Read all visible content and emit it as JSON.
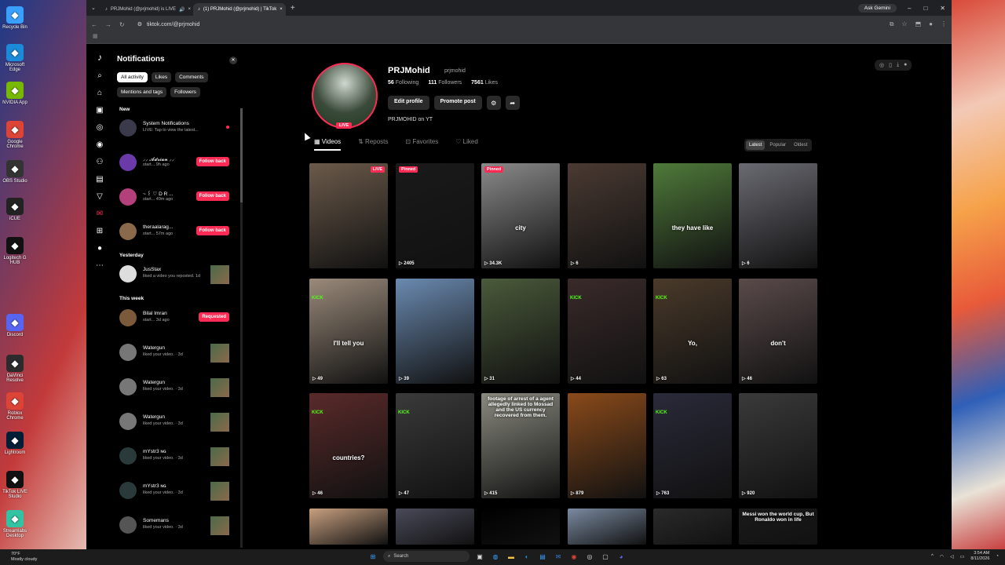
{
  "desktop": {
    "icons": [
      {
        "label": "Recycle Bin",
        "icon": "recycle-bin-icon",
        "color": "#3aa0ff"
      },
      {
        "label": "Microsoft Edge",
        "icon": "edge-icon",
        "color": "#1b8ad8"
      },
      {
        "label": "NVIDIA App",
        "icon": "nvidia-icon",
        "color": "#76b900"
      },
      {
        "label": "Google Chrome",
        "icon": "chrome-icon",
        "color": "#db4437"
      },
      {
        "label": "OBS Studio",
        "icon": "obs-icon",
        "color": "#333333"
      },
      {
        "label": "iCUE",
        "icon": "icue-icon",
        "color": "#222222"
      },
      {
        "label": "Logitech G HUB",
        "icon": "logitech-icon",
        "color": "#111111"
      },
      {
        "label": "Discord",
        "icon": "discord-icon",
        "color": "#5865f2"
      },
      {
        "label": "DaVinci Resolve",
        "icon": "davinci-icon",
        "color": "#2b2b2b"
      },
      {
        "label": "Roblox Chrome",
        "icon": "chrome-icon",
        "color": "#db4437"
      },
      {
        "label": "Lightroom",
        "icon": "lightroom-icon",
        "color": "#001e36"
      },
      {
        "label": "TikTok LIVE Studio",
        "icon": "tiktok-icon",
        "color": "#111111"
      },
      {
        "label": "Streamlabs Desktop",
        "icon": "streamlabs-icon",
        "color": "#31c3a2"
      }
    ]
  },
  "browser": {
    "tabs": [
      {
        "title": "PRJMohid (@prjmohid) is LIVE",
        "active": false
      },
      {
        "title": "(1) PRJMohid (@prjmohid) | TikTok",
        "active": true
      }
    ],
    "gemini_label": "Ask Gemini",
    "url": "tiktok.com/@prjmohid"
  },
  "notifications": {
    "title": "Notifications",
    "filters": [
      "All activity",
      "Likes",
      "Comments",
      "Mentions and tags",
      "Followers"
    ],
    "sections": {
      "new": "New",
      "yesterday": "Yesterday",
      "this_week": "This week"
    },
    "items": [
      {
        "name": "System Notifications",
        "sub": "LIVE: Tap to view the latest...",
        "action": "",
        "avatar_color": "#3a3a4a"
      },
      {
        "name": "⸝⸝ 𝓐𝓭𝓻𝓲𝓪𝓷 ⸝⸝",
        "sub": "start... 9h ago",
        "action": "Follow back",
        "avatar_color": "#6a3aa8"
      },
      {
        "name": "~ ꒰ ♡ D R ...",
        "sub": "start... 49m ago",
        "action": "Follow back",
        "avatar_color": "#b3407a"
      },
      {
        "name": "theraalarag...",
        "sub": "start... 57m ago",
        "action": "Follow back",
        "avatar_color": "#8a6a4a"
      },
      {
        "name": "JusStax",
        "sub": "liked a video you reposted. 1d",
        "action": "",
        "avatar_color": "#dddddd"
      },
      {
        "name": "Bilal Imran",
        "sub": "start... 3d ago",
        "action": "Requested",
        "avatar_color": "#7a5a3a"
      },
      {
        "name": "Watergun",
        "sub": "liked your video. · 3d",
        "action": "",
        "avatar_color": "#777777"
      },
      {
        "name": "Watergun",
        "sub": "liked your video. · 3d",
        "action": "",
        "avatar_color": "#777777"
      },
      {
        "name": "Watergun",
        "sub": "liked your video. · 3d",
        "action": "",
        "avatar_color": "#777777"
      },
      {
        "name": "mYstr3 ɴɢ",
        "sub": "liked your video. · 3d",
        "action": "",
        "avatar_color": "#2a3a3a"
      },
      {
        "name": "mYstr3 ɴɢ",
        "sub": "liked your video. · 3d",
        "action": "",
        "avatar_color": "#2a3a3a"
      },
      {
        "name": "Somemans",
        "sub": "liked your video. · 3d",
        "action": "",
        "avatar_color": "#555555"
      }
    ]
  },
  "profile": {
    "name": "PRJMohid",
    "handle": "prjmohid",
    "following": "56",
    "following_label": "Following",
    "followers": "111",
    "followers_label": "Followers",
    "likes": "7561",
    "likes_label": "Likes",
    "live_label": "LIVE",
    "edit_label": "Edit profile",
    "promote_label": "Promote post",
    "bio": "PRJMOHID on YT",
    "tabs": [
      "Videos",
      "Reposts",
      "Favorites",
      "Liked"
    ],
    "sort": [
      "Latest",
      "Popular",
      "Oldest"
    ]
  },
  "videos": [
    {
      "views": "",
      "badge": "LIVE",
      "caption": "",
      "kick": "",
      "color": "#6b5a4a"
    },
    {
      "views": "2405",
      "badge": "Pinned",
      "caption": "",
      "kick": "",
      "color": "#1a1a1a"
    },
    {
      "views": "34.3K",
      "badge": "Pinned",
      "caption": "city",
      "kick": "",
      "color": "#8a8a8a"
    },
    {
      "views": "6",
      "badge": "",
      "caption": "",
      "kick": "",
      "color": "#4a3a32"
    },
    {
      "views": "",
      "badge": "",
      "caption": "they have like",
      "kick": "",
      "color": "#4f7a3a"
    },
    {
      "views": "6",
      "badge": "",
      "caption": "",
      "kick": "",
      "color": "#6a6a72"
    },
    {
      "views": "49",
      "badge": "",
      "caption": "I'll tell you",
      "kick": "KICK",
      "color": "#9a8a7a"
    },
    {
      "views": "39",
      "badge": "",
      "caption": "",
      "kick": "",
      "color": "#6a8ab0"
    },
    {
      "views": "31",
      "badge": "",
      "caption": "",
      "kick": "",
      "color": "#4a5a3a"
    },
    {
      "views": "44",
      "badge": "",
      "caption": "",
      "kick": "KICK",
      "color": "#3a2a2a"
    },
    {
      "views": "63",
      "badge": "",
      "caption": "Yo,",
      "kick": "KICK",
      "color": "#4a3a2a"
    },
    {
      "views": "46",
      "badge": "",
      "caption": "don't",
      "kick": "",
      "color": "#5a4a4a"
    },
    {
      "views": "46",
      "badge": "",
      "caption": "countries?",
      "kick": "KICK",
      "color": "#5a2a2a"
    },
    {
      "views": "47",
      "badge": "",
      "caption": "",
      "kick": "KICK",
      "color": "#3a3a3a"
    },
    {
      "views": "415",
      "badge": "",
      "caption": "footage of arrest of a agent allegedly linked to Mossad and the US currency recovered from them.",
      "kick": "",
      "color": "#8a8a80"
    },
    {
      "views": "879",
      "badge": "",
      "caption": "",
      "kick": "",
      "color": "#8a4a1a"
    },
    {
      "views": "763",
      "badge": "",
      "caption": "",
      "kick": "KICK",
      "color": "#2a2a3a"
    },
    {
      "views": "920",
      "badge": "",
      "caption": "",
      "kick": "",
      "color": "#3a3a3a"
    },
    {
      "views": "",
      "badge": "",
      "caption": "",
      "kick": "",
      "color": "#c8a080"
    },
    {
      "views": "",
      "badge": "",
      "caption": "",
      "kick": "",
      "color": "#4a4a5a"
    },
    {
      "views": "",
      "badge": "",
      "caption": "",
      "kick": "",
      "color": "#000000"
    },
    {
      "views": "",
      "badge": "",
      "caption": "",
      "kick": "",
      "color": "#7a8aa0"
    },
    {
      "views": "",
      "badge": "",
      "caption": "",
      "kick": "",
      "color": "#2a2a2a"
    },
    {
      "views": "",
      "badge": "",
      "caption": "Messi won the world cup, But Ronaldo won in life",
      "kick": "",
      "color": "#1a1a1a"
    }
  ],
  "taskbar": {
    "weather_temp": "70°F",
    "weather_desc": "Mostly cloudy",
    "search_placeholder": "Search",
    "time": "3:54 AM",
    "date": "8/11/2026"
  }
}
